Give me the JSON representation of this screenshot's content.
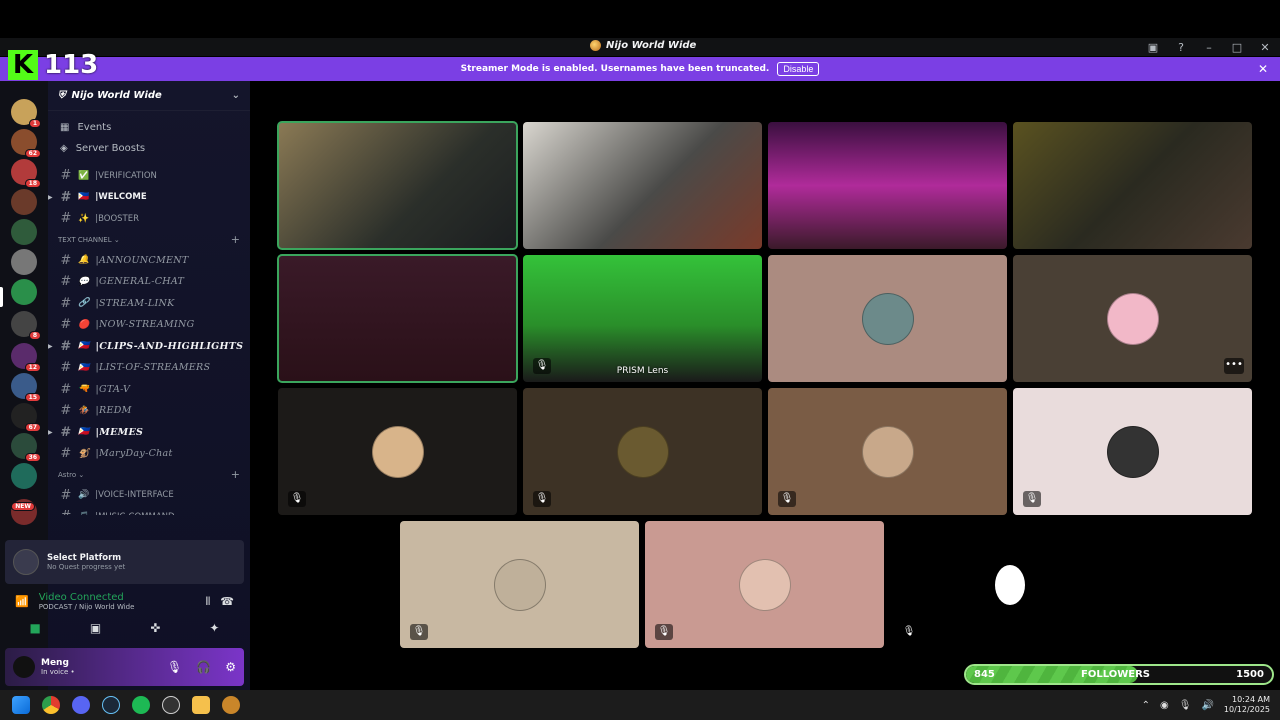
{
  "overlay": {
    "brand": "K",
    "count": "113"
  },
  "window": {
    "title": "Nijo World Wide"
  },
  "banner": {
    "text": "Streamer Mode is enabled. Usernames have been truncated.",
    "disable_label": "Disable"
  },
  "server": {
    "name": "Nijo World Wide",
    "events": "Events",
    "boosts": "Server Boosts"
  },
  "guild_badges": [
    "1",
    "62",
    "18",
    "",
    "",
    "",
    "",
    "8",
    "12",
    "15",
    "67",
    "36",
    "",
    "NEW"
  ],
  "channels_top": [
    {
      "emoji": "✅",
      "name": "|VERIFICATION"
    },
    {
      "emoji": "🇵🇭",
      "name": "|WELCOME"
    },
    {
      "emoji": "✨",
      "name": "|BOOSTER"
    }
  ],
  "category_text": "TEXT CHANNEL",
  "channels_text": [
    {
      "emoji": "🔔",
      "name": "|ANNOUNCMENT"
    },
    {
      "emoji": "💬",
      "name": "|GENERAL-CHAT"
    },
    {
      "emoji": "🔗",
      "name": "|STREAM-LINK"
    },
    {
      "emoji": "🔴",
      "name": "|NOW-STREAMING"
    },
    {
      "emoji": "🇵🇭",
      "name": "|CLIPS-AND-HIGHLIGHTS"
    },
    {
      "emoji": "🇵🇭",
      "name": "|LIST-OF-STREAMERS"
    },
    {
      "emoji": "🔫",
      "name": "|GTA-V"
    },
    {
      "emoji": "🏇",
      "name": "|REDM"
    },
    {
      "emoji": "🇵🇭",
      "name": "|MEMES"
    },
    {
      "emoji": "🐒",
      "name": "|MaryDay-Chat"
    }
  ],
  "category_astro": "Astro",
  "channels_astro": [
    {
      "emoji": "🔊",
      "name": "|VOICE-INTERFACE"
    },
    {
      "emoji": "🎵",
      "name": "|MUSIC-COMMAND"
    }
  ],
  "quest": {
    "title": "Select Platform",
    "subtitle": "No Quest progress yet"
  },
  "voice": {
    "status": "Video Connected",
    "channel": "PODCAST / Nijo World Wide"
  },
  "user": {
    "name": "Meng",
    "status": "In voice •"
  },
  "tiles": [
    {
      "label": ""
    },
    {
      "label": ""
    },
    {
      "label": ""
    },
    {
      "label": ""
    },
    {
      "label": ""
    },
    {
      "label": "PRISM Lens"
    },
    {
      "label": ""
    },
    {
      "label": ""
    },
    {
      "label": ""
    },
    {
      "label": ""
    },
    {
      "label": ""
    },
    {
      "label": ""
    },
    {
      "label": ""
    },
    {
      "label": ""
    },
    {
      "label": ""
    }
  ],
  "followers": {
    "current": "845",
    "label": "FOLLOWERS",
    "goal": "1500",
    "fraction": 0.563
  },
  "clock": {
    "time": "10:24 AM",
    "date": "10/12/2025"
  }
}
